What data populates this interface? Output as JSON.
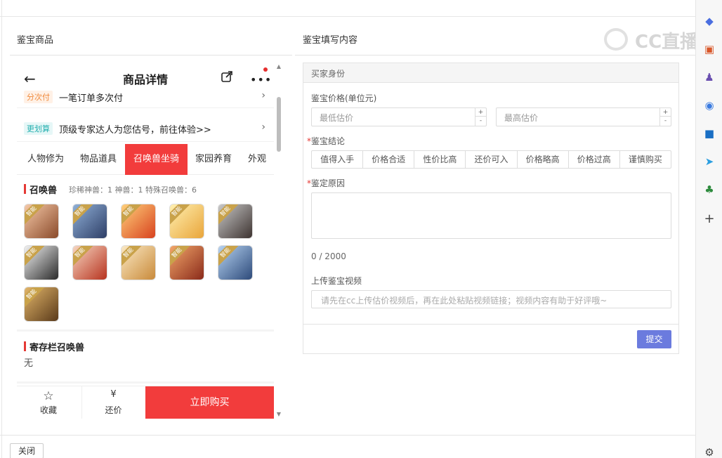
{
  "left_panel": {
    "title": "鉴宝商品"
  },
  "right_panel": {
    "title": "鉴宝填写内容"
  },
  "watermark": {
    "text": "CC直播"
  },
  "phone": {
    "nav_title": "商品详情",
    "promos": [
      {
        "tag": "分次付",
        "text": "一笔订单多次付"
      },
      {
        "tag": "更划算",
        "text": "顶级专家达人为您估号，前往体验>>"
      }
    ],
    "tabs": [
      "人物修为",
      "物品道具",
      "召唤兽坐骑",
      "家园养育",
      "外观"
    ],
    "summon": {
      "title": "召唤兽",
      "stats": "珍稀神兽：1   神兽：1   特殊召唤兽：6",
      "pet_badge": "智能"
    },
    "storage": {
      "title": "寄存栏召唤兽",
      "value": "无"
    },
    "bottom": {
      "favorite": "收藏",
      "bargain": "还价",
      "buy": "立即购买"
    }
  },
  "form": {
    "header": "买家身份",
    "price_label": "鉴宝价格(单位元)",
    "min_placeholder": "最低估价",
    "max_placeholder": "最高估价",
    "conclusion_label": "鉴宝结论",
    "conclusion_options": [
      "值得入手",
      "价格合适",
      "性价比高",
      "还价可入",
      "价格略高",
      "价格过高",
      "谨慎购买"
    ],
    "reason_label": "鉴定原因",
    "reason_count": "0 / 2000",
    "video_label": "上传鉴宝视频",
    "video_placeholder": "请先在cc上传估价视频后，再在此处粘贴视频链接；视频内容有助于好评哦~",
    "submit": "提交"
  },
  "footer": {
    "close": "关闭"
  },
  "colors": {
    "accent_red": "#f23c3c",
    "submit_blue": "#6b7bde"
  }
}
